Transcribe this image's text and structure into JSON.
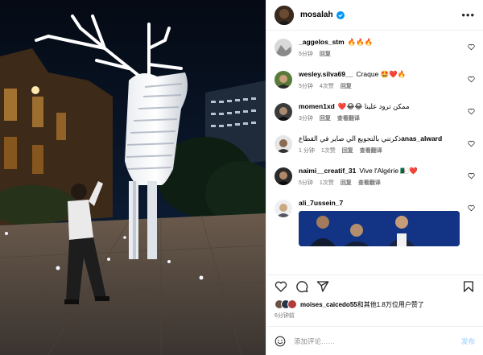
{
  "post_header": {
    "username": "mosalah",
    "verified_icon": "verified-badge-icon",
    "more_icon": "more-options-icon",
    "accent": "#0095f6"
  },
  "comments": [
    {
      "username": "_aggelos_stm",
      "text": "🔥🔥🔥",
      "time": "5分钟",
      "likes": "",
      "reply": "回复",
      "show_replies": ""
    },
    {
      "username": "wesley.silva69__",
      "text": "Craque 🤩❤️🔥",
      "time": "5分钟",
      "likes": "4次赞",
      "reply": "回复",
      "show_replies": ""
    },
    {
      "username": "momen1xd",
      "text": "❤️😂😂 ممكن ترود علينا",
      "time": "3分钟",
      "likes": "",
      "reply": "回复",
      "show_replies": "查看翻译"
    },
    {
      "username": "anas_alward",
      "text": "ذكرتني بالتجويع الي صاير في القطاع",
      "time": "1 分钟",
      "likes": "1次赞",
      "reply": "回复",
      "show_replies": "查看翻译"
    },
    {
      "username": "naimi__creatif_31",
      "text": "Vive l'Algérie 🇩🇿❤️",
      "time": "5分钟",
      "likes": "1次赞",
      "reply": "回复",
      "show_replies": "查看翻译"
    },
    {
      "username": "ali_7ussein_7",
      "text": "",
      "time": "",
      "likes": "",
      "reply": "",
      "show_replies": ""
    }
  ],
  "actions": {
    "like_icon": "heart-icon",
    "comment_icon": "comment-icon",
    "share_icon": "share-icon",
    "save_icon": "bookmark-icon"
  },
  "likes": {
    "first_liker": "moises_caicedo55",
    "rest": "和其他1.8万位用户赞了"
  },
  "timestamp": "6分钟前",
  "add_comment": {
    "placeholder": "添加评论……",
    "post_label": "发布",
    "emoji_icon": "emoji-icon"
  }
}
